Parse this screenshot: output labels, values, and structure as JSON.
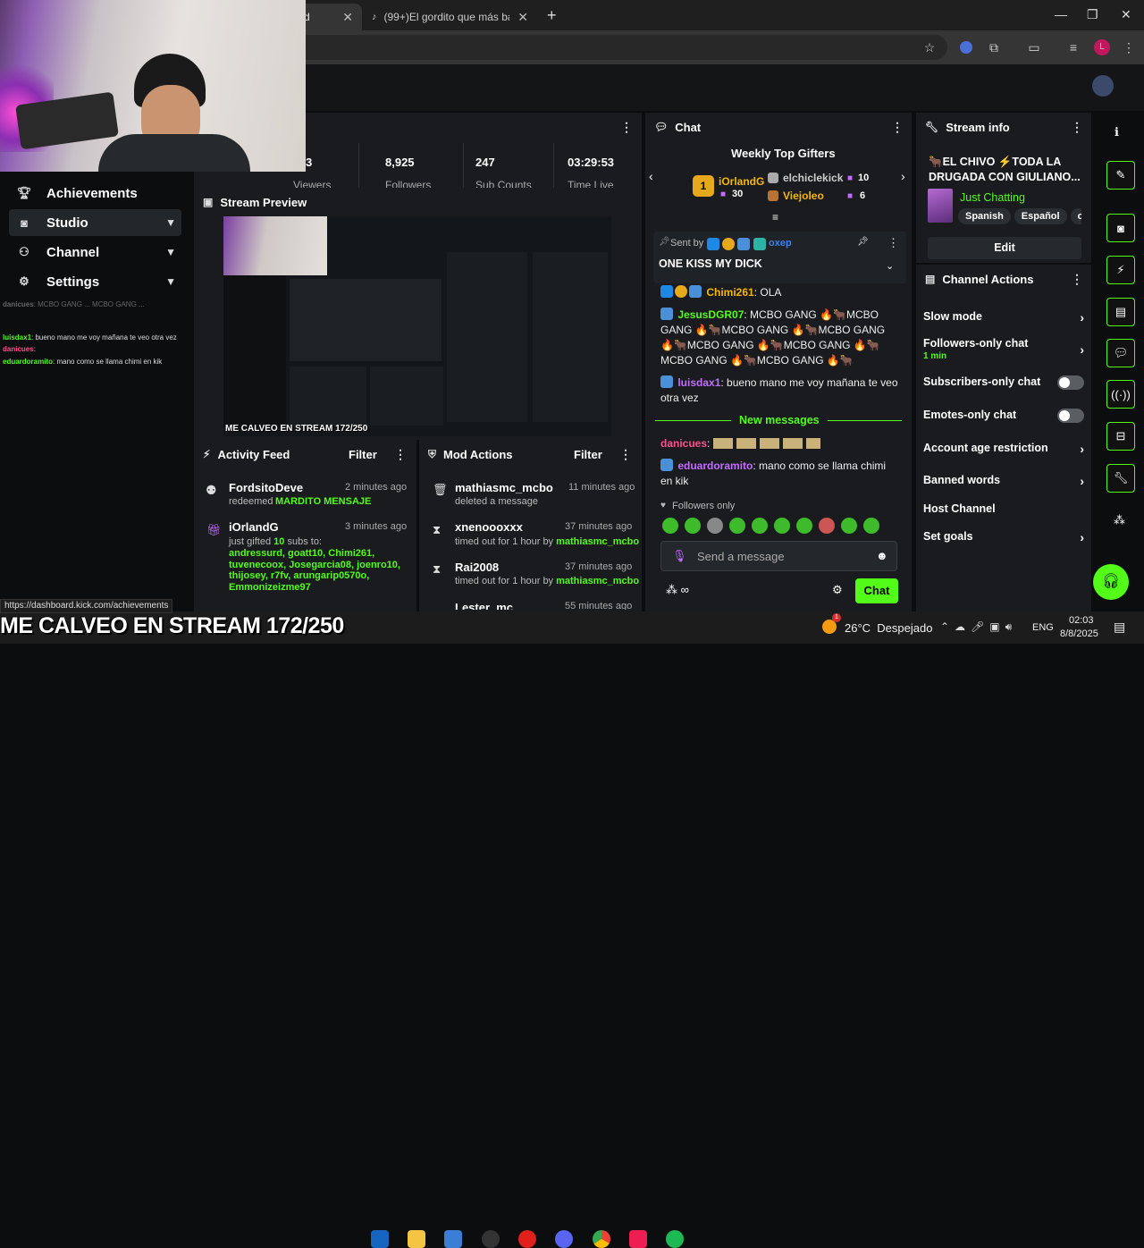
{
  "browser": {
    "tab1_label": "d",
    "tab2_label": "(99+)El gordito que más baila",
    "new_tab": "+"
  },
  "sidebar": {
    "items": [
      {
        "label": "Achievements",
        "icon": "trophy-icon"
      },
      {
        "label": "Studio",
        "icon": "studio-icon"
      },
      {
        "label": "Channel",
        "icon": "channel-icon"
      },
      {
        "label": "Settings",
        "icon": "gear-icon"
      }
    ],
    "mini_chat": [
      {
        "user": "danicues",
        "text": ": MCBO GANG ... MCBO GANG ..."
      },
      {
        "user": "luisdax1",
        "text": ": bueno mano me voy mañana te veo otra vez"
      },
      {
        "user": "danicues",
        "text": ":"
      },
      {
        "user": "eduardoramito",
        "text": ": mano como se llama chimi en kik"
      }
    ]
  },
  "stats": [
    {
      "value": "3",
      "label": "Viewers"
    },
    {
      "value": "8,925",
      "label": "Followers"
    },
    {
      "value": "247",
      "label": "Sub Counts"
    },
    {
      "value": "03:29:53",
      "label": "Time Live"
    }
  ],
  "preview": {
    "title": "Stream Preview",
    "caption": "ME CALVEO EN STREAM 172/250"
  },
  "activity": {
    "title": "Activity Feed",
    "filter": "Filter",
    "items": [
      {
        "name": "FordsitoDeve",
        "time": "2 minutes ago",
        "action": "redeemed",
        "detail": "MARDITO MENSAJE"
      },
      {
        "name": "iOrlandG",
        "time": "3 minutes ago",
        "action": "just gifted",
        "count": "10",
        "action2": "subs to:",
        "recipients": "andressurd, goatt10, Chimi261, tuvenecoox, Josegarcia08, joenro10, thijosey, r7fv, arungarip0570o, Emmonizeizme97"
      }
    ]
  },
  "mod": {
    "title": "Mod Actions",
    "filter": "Filter",
    "items": [
      {
        "name": "mathiasmc_mcbo",
        "time": "11 minutes ago",
        "action": "deleted a message"
      },
      {
        "name": "xnenoooxxx",
        "time": "37 minutes ago",
        "action": "timed out for 1 hour by",
        "by": "mathiasmc_mcbo"
      },
      {
        "name": "Rai2008",
        "time": "37 minutes ago",
        "action": "timed out for 1 hour by",
        "by": "mathiasmc_mcbo"
      },
      {
        "name": "Lester_mc",
        "time": "55 minutes ago"
      }
    ]
  },
  "chat": {
    "title": "Chat",
    "gifters_title": "Weekly Top Gifters",
    "gifter1": {
      "name": "iOrlandG",
      "count": "30",
      "rank": "1"
    },
    "gifter2": {
      "name": "elchiclekick",
      "count": "10"
    },
    "gifter3": {
      "name": "Viejoleo",
      "count": "6"
    },
    "pinned_sent_by": "Sent by",
    "pinned_user": "oxep",
    "pinned_msg": "ONE KISS MY DICK",
    "messages": [
      {
        "user": "Chimi261",
        "text": ": OLA"
      },
      {
        "user": "JesusDGR07",
        "text": ": MCBO GANG 🔥🐂MCBO GANG 🔥🐂MCBO GANG 🔥🐂MCBO GANG 🔥🐂MCBO GANG 🔥🐂MCBO GANG 🔥🐂MCBO GANG 🔥🐂MCBO GANG 🔥🐂"
      },
      {
        "user": "luisdax1",
        "text": ": bueno mano me voy mañana te veo otra vez"
      },
      {
        "user": "danicues",
        "text": ":"
      },
      {
        "user": "eduardoramito",
        "text": ": mano como se llama chimi en kik"
      }
    ],
    "new_messages": "New messages",
    "followers_only": "Followers only",
    "placeholder": "Send a message",
    "send_label": "Chat"
  },
  "stream_info": {
    "title": "Stream info",
    "stream_title": "🐂EL CHIVO ⚡TODA LA DRUGADA CON GIULIANO...",
    "category": "Just Chatting",
    "tags": [
      "Spanish",
      "Español",
      "col"
    ],
    "edit": "Edit"
  },
  "channel_actions": {
    "title": "Channel Actions",
    "items": [
      {
        "label": "Slow mode"
      },
      {
        "label": "Followers-only chat",
        "sub": "1 min"
      },
      {
        "label": "Subscribers-only chat"
      },
      {
        "label": "Emotes-only chat"
      },
      {
        "label": "Account age restriction"
      },
      {
        "label": "Banned words"
      },
      {
        "label": "Host Channel"
      },
      {
        "label": "Set goals"
      }
    ]
  },
  "status_url": "https://dashboard.kick.com/achievements",
  "taskbar": {
    "weather": "26°C  Despejado",
    "lang": "ENG",
    "time": "02:03",
    "date": "8/8/2025",
    "weather_badge": "1"
  },
  "colors": {
    "accent": "#53fc18",
    "panel": "#191b1f",
    "bg": "#0b0d0e"
  }
}
